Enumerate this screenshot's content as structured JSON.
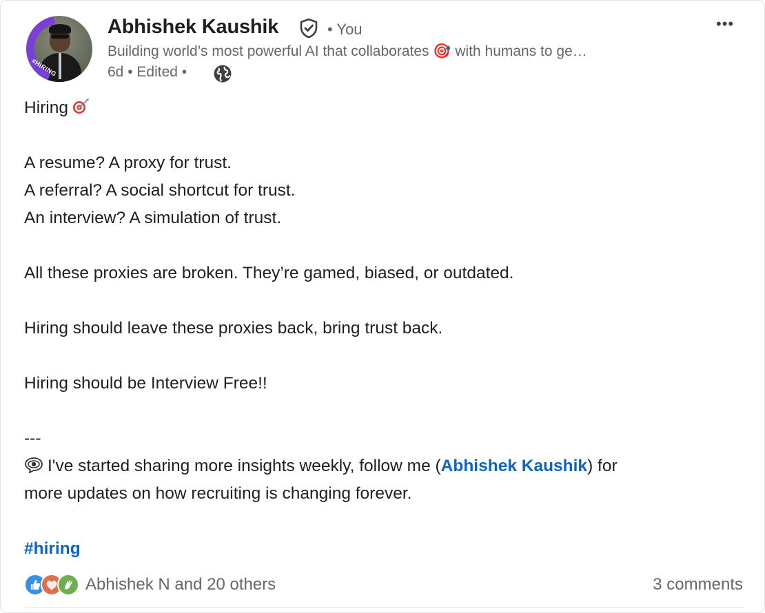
{
  "post": {
    "author": {
      "name": "Abhishek Kaushik",
      "connection": "• You",
      "headline": "Building world’s most powerful AI that collaborates 🎯 with humans to ge…",
      "avatar_badge": "#HIRING",
      "time": "6d",
      "edited": "• Edited •"
    },
    "body": {
      "title": "Hiring",
      "line1": "A resume? A proxy for trust.",
      "line2": "A referral? A social shortcut for trust.",
      "line3": "An interview? A simulation of trust.",
      "line4": "All these proxies are broken. They’re gamed, biased, or outdated.",
      "line5": "Hiring should leave these proxies back, bring trust back.",
      "line6": "Hiring should be Interview Free!!",
      "separator": "---",
      "follow_prefix": "I've started sharing more insights weekly, follow me (",
      "mention": "Abhishek Kaushik",
      "follow_suffix": ") for",
      "follow_line2": "more updates on how recruiting is changing forever.",
      "hashtag": "#hiring"
    },
    "footer": {
      "reactions_text": "Abhishek N and 20 others",
      "comments_text": "3 comments",
      "reaction_icons": [
        "like-icon",
        "love-icon",
        "celebrate-icon"
      ]
    },
    "icons": {
      "verified": "verified-shield-icon",
      "globe": "globe-icon",
      "more": "more-options-icon"
    },
    "colors": {
      "link": "#0a66c2",
      "muted": "#666666",
      "text": "#1f1f1f",
      "like": "#378fe9",
      "love": "#df704d",
      "celebrate": "#6dae4f"
    },
    "more_label": "•••"
  }
}
